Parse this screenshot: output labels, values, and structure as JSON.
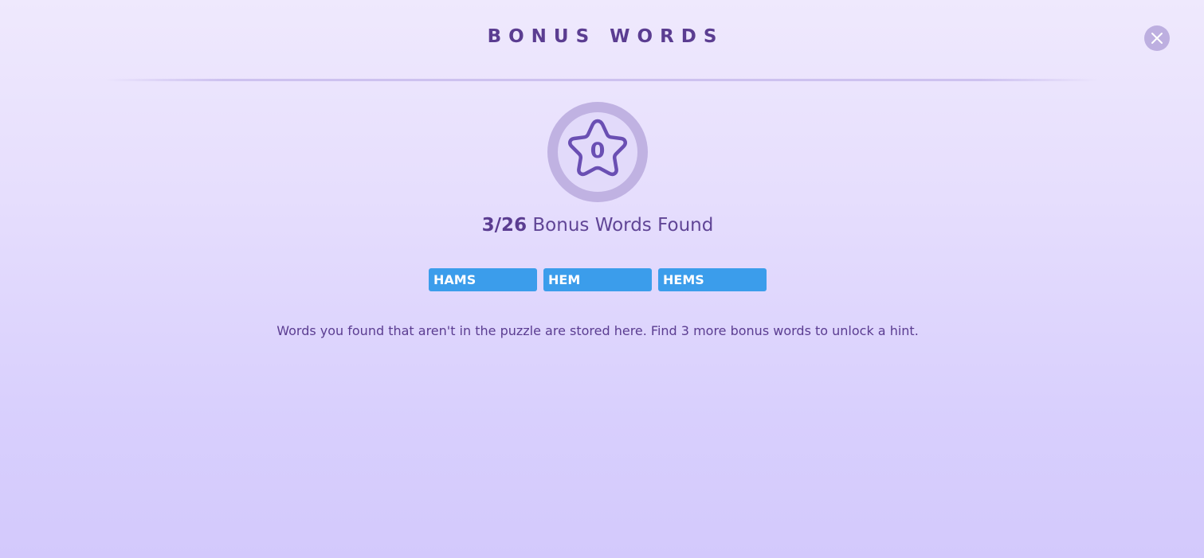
{
  "dialog": {
    "title": "BONUS WORDS",
    "close_icon": "close-icon"
  },
  "badge": {
    "icon": "star-icon",
    "count": "0"
  },
  "progress": {
    "fraction": "3/26",
    "label": "Bonus Words Found"
  },
  "bonus_words": [
    "HAMS",
    "HEM",
    "HEMS"
  ],
  "info_text": "Words you found that aren't in the puzzle are stored here. Find 3 more bonus words to unlock a hint.",
  "colors": {
    "accent": "#5b3d91",
    "chip": "#3b9deb",
    "badge_ring": "#c0b2e2",
    "background_top": "#efe9fd",
    "background_bottom": "#d3c9fc"
  }
}
